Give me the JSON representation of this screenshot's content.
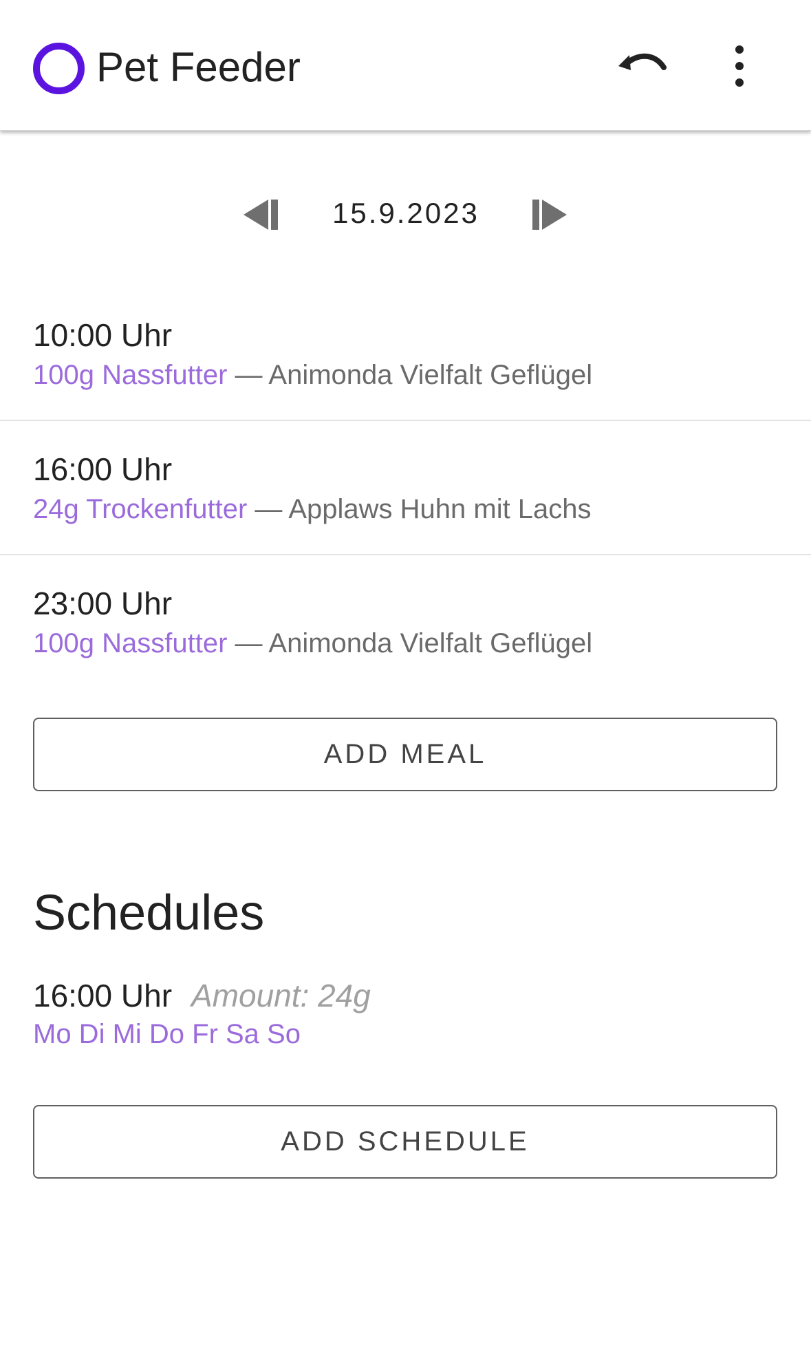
{
  "app": {
    "title": "Pet Feeder",
    "accent_color": "#5b14e0",
    "link_color": "#9b6bdc"
  },
  "toolbar": {
    "undo_icon": "undo-icon",
    "menu_icon": "more-vert-icon"
  },
  "date_nav": {
    "date": "15.9.2023",
    "prev_icon": "skip-previous-icon",
    "next_icon": "skip-next-icon"
  },
  "meals": [
    {
      "time": "10:00 Uhr",
      "amount": "100g Nassfutter",
      "separator": "—",
      "food": "Animonda Vielfalt Geflügel"
    },
    {
      "time": "16:00 Uhr",
      "amount": "24g Trockenfutter",
      "separator": "—",
      "food": "Applaws Huhn mit Lachs"
    },
    {
      "time": "23:00 Uhr",
      "amount": "100g Nassfutter",
      "separator": "—",
      "food": "Animonda Vielfalt Geflügel"
    }
  ],
  "add_meal_label": "ADD MEAL",
  "schedules": {
    "title": "Schedules",
    "items": [
      {
        "time": "16:00 Uhr",
        "amount": "Amount: 24g",
        "days": "Mo Di Mi Do Fr Sa So"
      }
    ],
    "add_label": "ADD SCHEDULE"
  }
}
